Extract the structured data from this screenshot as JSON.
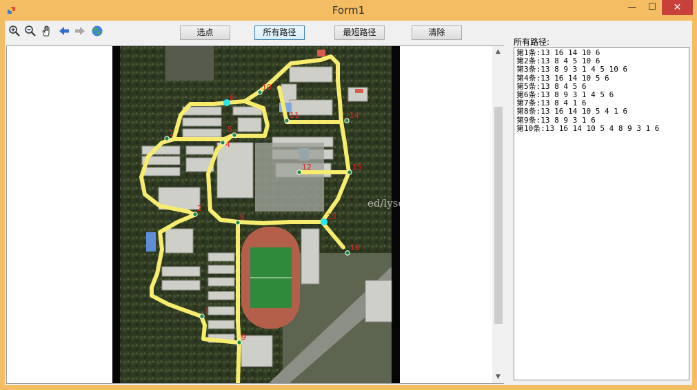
{
  "window": {
    "title": "Form1",
    "minimize_glyph": "—",
    "maximize_glyph": "☐",
    "close_glyph": "✕"
  },
  "toolbar": {
    "icons": [
      "zoom-in-icon",
      "zoom-out-icon",
      "pan-hand-icon",
      "back-arrow-icon",
      "forward-arrow-icon",
      "globe-full-extent-icon"
    ],
    "buttons": {
      "select_point": "选点",
      "all_paths": "所有路径",
      "shortest_path": "最短路径",
      "clear": "清除"
    }
  },
  "map": {
    "node_labels": [
      "1",
      "2",
      "3",
      "4",
      "5",
      "6",
      "8",
      "9",
      "10",
      "11",
      "12",
      "13",
      "14",
      "15",
      "16"
    ],
    "watermark": "ed/lysc_forever",
    "colors": {
      "road": "#f7ec6e",
      "node": "#1e8a3a",
      "endpoint": "#26e6f0",
      "label": "#e2231a"
    }
  },
  "route_panel": {
    "label": "所有路径:",
    "routes": [
      "第1条:13 16 14 10 6",
      "第2条:13 8 4 5 10 6",
      "第3条:13 8 9 3 1 4 5 10 6",
      "第4条:13 16 14 10 5 6",
      "第5条:13 8 4 5 6",
      "第6条:13 8 9 3 1 4 5 6",
      "第7条:13 8 4 1 6",
      "第8条:13 16 14 10 5 4 1 6",
      "第9条:13 8 9 3 1 6",
      "第10条:13 16 14 10 5 4 8 9 3 1 6"
    ]
  }
}
